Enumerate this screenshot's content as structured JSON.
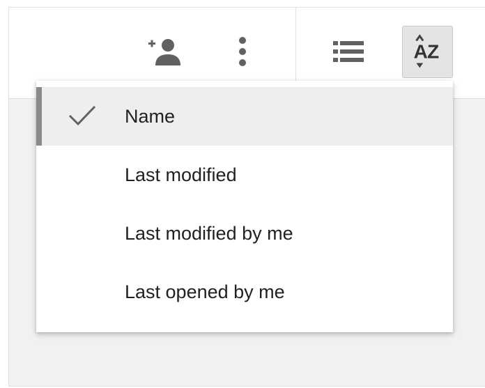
{
  "toolbar": {
    "add_person_icon": "person-add-icon",
    "more_icon": "more-vert-icon",
    "list_icon": "list-view-icon",
    "sort_icon": "sort-az-icon",
    "sort_letters": {
      "a": "A",
      "z": "Z"
    }
  },
  "sort_menu": {
    "items": [
      {
        "label": "Name",
        "selected": true
      },
      {
        "label": "Last modified",
        "selected": false
      },
      {
        "label": "Last modified by me",
        "selected": false
      },
      {
        "label": "Last opened by me",
        "selected": false
      }
    ]
  },
  "colors": {
    "icon": "#616161",
    "selected_bg": "#eeeeee",
    "selected_bar": "#8a8a8a",
    "text": "#212121"
  }
}
